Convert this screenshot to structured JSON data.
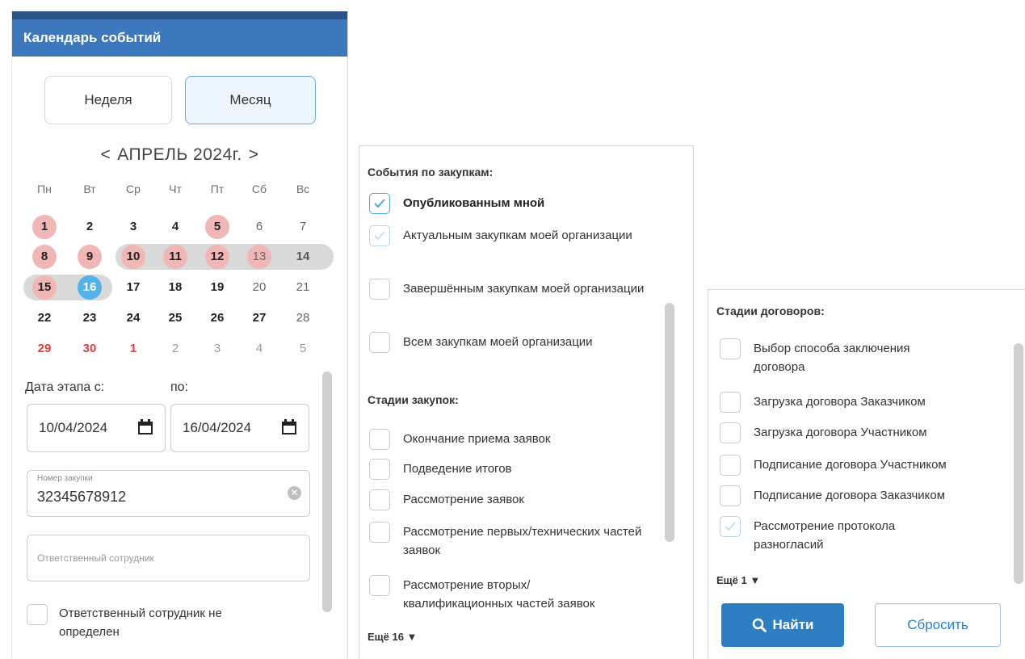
{
  "calendar_panel": {
    "title": "Календарь событий",
    "view_week": "Неделя",
    "view_month": "Месяц",
    "prev_arrow": "<",
    "next_arrow": ">",
    "month_label": "АПРЕЛЬ 2024г.",
    "weekdays": [
      "Пн",
      "Вт",
      "Ср",
      "Чт",
      "Пт",
      "Сб",
      "Вс"
    ],
    "weeks": [
      [
        "1",
        "2",
        "3",
        "4",
        "5",
        "6",
        "7"
      ],
      [
        "8",
        "9",
        "10",
        "11",
        "12",
        "13",
        "14"
      ],
      [
        "15",
        "16",
        "17",
        "18",
        "19",
        "20",
        "21"
      ],
      [
        "22",
        "23",
        "24",
        "25",
        "26",
        "27",
        "28"
      ],
      [
        "29",
        "30",
        "1",
        "2",
        "3",
        "4",
        "5"
      ]
    ],
    "date_from_label": "Дата этапа с:",
    "date_to_label": "по:",
    "date_from": "10/04/2024",
    "date_to": "16/04/2024",
    "purchase_number_label": "Номер закупки",
    "purchase_number": "32345678912",
    "responsible_placeholder": "Ответственный сотрудник",
    "responsible_undefined_label": "Ответственный сотрудник не определен"
  },
  "purchase_panel": {
    "events_title": "События по закупкам:",
    "events": [
      {
        "label": "Опубликованным мной",
        "checked": true
      },
      {
        "label": "Актуальным закупкам моей организации",
        "checked": true
      },
      {
        "label": "Завершённым закупкам моей организации",
        "checked": false
      },
      {
        "label": "Всем закупкам моей организации",
        "checked": false
      }
    ],
    "stages_title": "Стадии закупок:",
    "stages": [
      {
        "label": "Окончание приема заявок",
        "checked": false
      },
      {
        "label": "Подведение итогов",
        "checked": false
      },
      {
        "label": "Рассмотрение заявок",
        "checked": false
      },
      {
        "label": "Рассмотрение первых/технических частей заявок",
        "checked": false
      },
      {
        "label": "Рассмотрение вторых/ квалификационных частей заявок",
        "checked": false
      }
    ],
    "more": "Ещё 16 ▼"
  },
  "contract_panel": {
    "stages_title": "Стадии договоров:",
    "stages": [
      {
        "label": "Выбор способа заключения договора",
        "checked": false
      },
      {
        "label": "Загрузка договора Заказчиком",
        "checked": false
      },
      {
        "label": "Загрузка договора Участником",
        "checked": false
      },
      {
        "label": "Подписание договора Участником",
        "checked": false
      },
      {
        "label": "Подписание договора Заказчиком",
        "checked": false
      },
      {
        "label": "Рассмотрение протокола разногласий",
        "checked": true
      }
    ],
    "more": "Ещё 1 ▼",
    "find_button": "Найти",
    "reset_button": "Сбросить"
  },
  "colors": {
    "header_blue": "#3d77bc",
    "accent_blue": "#2e7fc1",
    "event_red": "#f1b6b6",
    "today_blue": "#53b3e8",
    "range_gray": "#d9d9d9"
  }
}
